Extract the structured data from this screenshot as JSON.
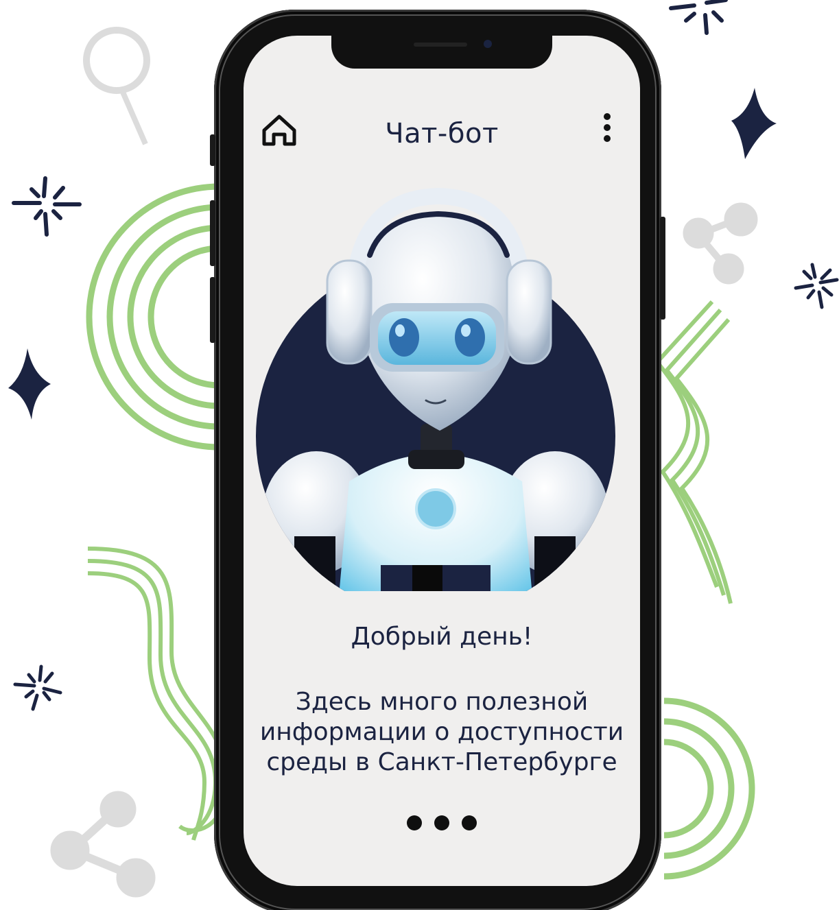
{
  "header": {
    "title": "Чат-бот",
    "home_icon": "home-icon",
    "menu_icon": "more-vertical-icon"
  },
  "bot": {
    "avatar": "robot-avatar",
    "greeting": "Добрый день!",
    "message_lines": [
      "Здесь много полезной",
      "информации о доступности",
      "среды в Санкт-Петербурге"
    ],
    "typing_indicator": "typing-dots-icon"
  },
  "colors": {
    "navy": "#1b2341",
    "screen_bg": "#f0efee",
    "deco_green": "#9ccf7d",
    "deco_grey": "#dcdcdc"
  }
}
